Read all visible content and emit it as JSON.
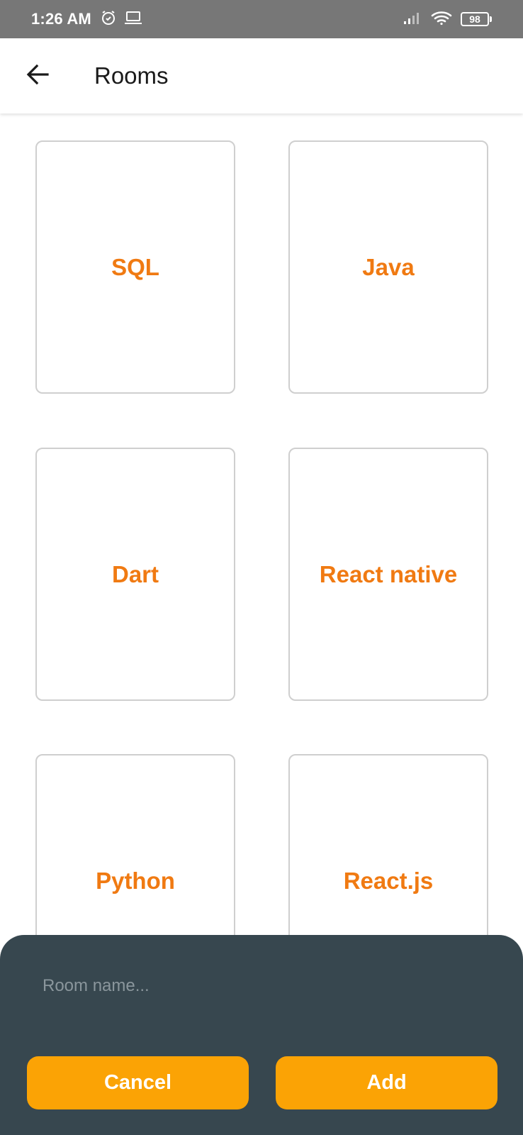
{
  "status_bar": {
    "time": "1:26 AM",
    "battery": "98",
    "icons": [
      "alarm-icon",
      "laptop-icon",
      "signal-icon",
      "wifi-icon",
      "battery-icon"
    ]
  },
  "app_bar": {
    "title": "Rooms",
    "back_icon": "arrow-left-icon"
  },
  "rooms": [
    {
      "label": "SQL"
    },
    {
      "label": "Java"
    },
    {
      "label": "Dart"
    },
    {
      "label": "React native"
    },
    {
      "label": "Python"
    },
    {
      "label": "React.js"
    }
  ],
  "sheet": {
    "input_value": "",
    "input_placeholder": "Room name...",
    "cancel_label": "Cancel",
    "add_label": "Add"
  },
  "colors": {
    "status_bar": "#777777",
    "room_label": "#f07a12",
    "sheet_background": "#37474f",
    "button": "#fba305"
  }
}
